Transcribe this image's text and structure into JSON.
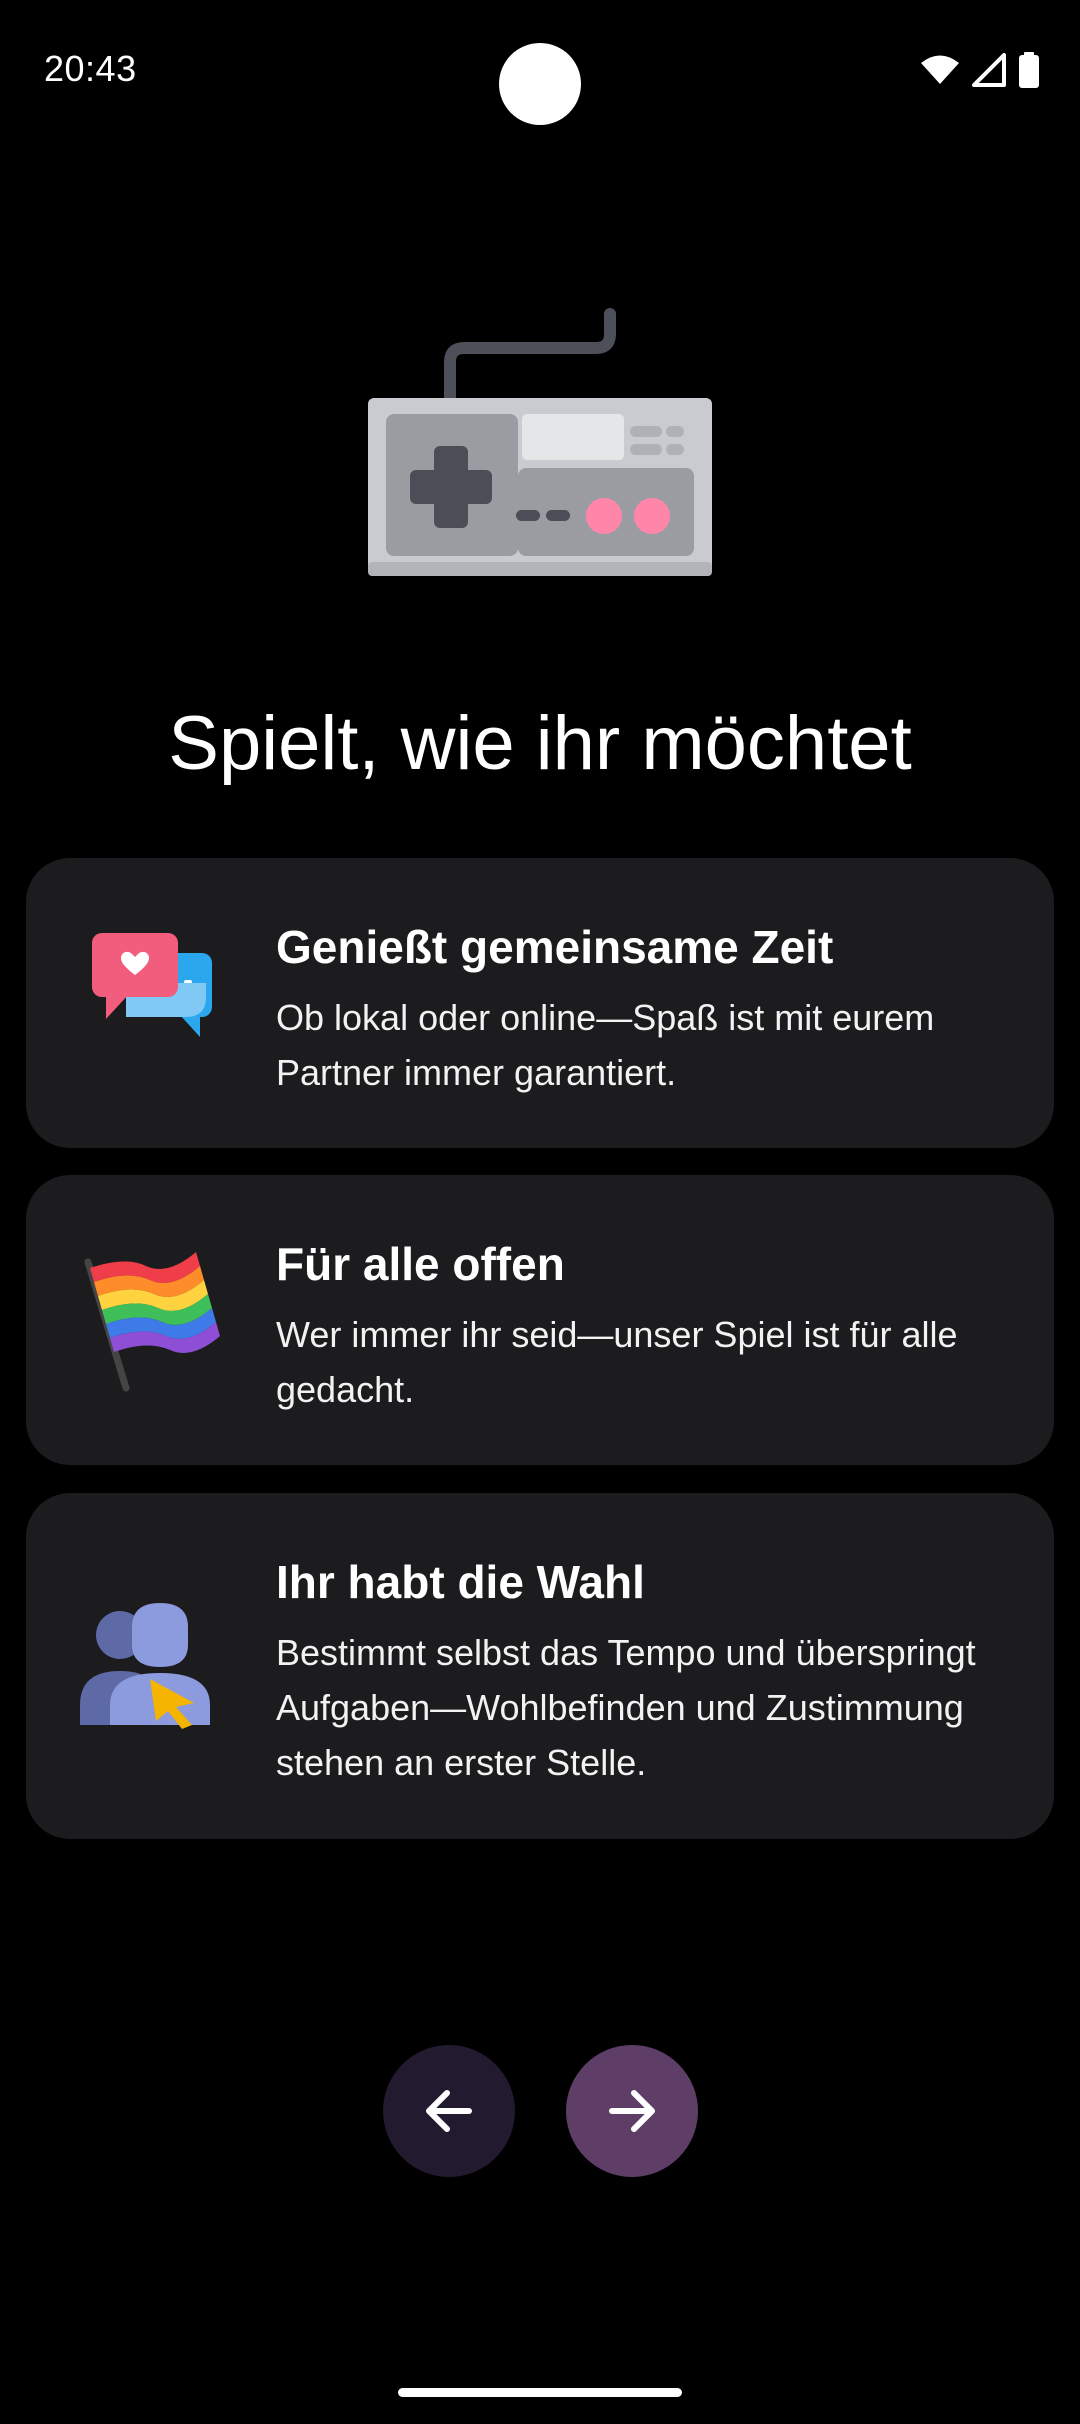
{
  "status_bar": {
    "time": "20:43",
    "icons": [
      "wifi-icon",
      "signal-icon",
      "battery-icon"
    ]
  },
  "hero": {
    "icon": "gamepad-icon"
  },
  "page": {
    "title": "Spielt, wie ihr möchtet"
  },
  "features": [
    {
      "icon": "chat-bubbles-icon",
      "title": "Genießt gemeinsame Zeit",
      "body": "Ob lokal oder online—Spaß ist mit eurem Partner immer garantiert."
    },
    {
      "icon": "rainbow-flag-icon",
      "title": "Für alle offen",
      "body": "Wer immer ihr seid—unser Spiel ist für alle gedacht."
    },
    {
      "icon": "users-cursor-icon",
      "title": "Ihr habt die Wahl",
      "body": "Bestimmt selbst das Tempo und überspringt Aufgaben—Wohlbefinden und Zustimmung stehen an erster Stelle."
    }
  ],
  "navigation": {
    "back_icon": "arrow-left-icon",
    "next_icon": "arrow-right-icon"
  },
  "colors": {
    "background": "#000000",
    "card": "#1c1c1e",
    "back_button": "#221a2e",
    "next_button": "#5e3e66"
  }
}
